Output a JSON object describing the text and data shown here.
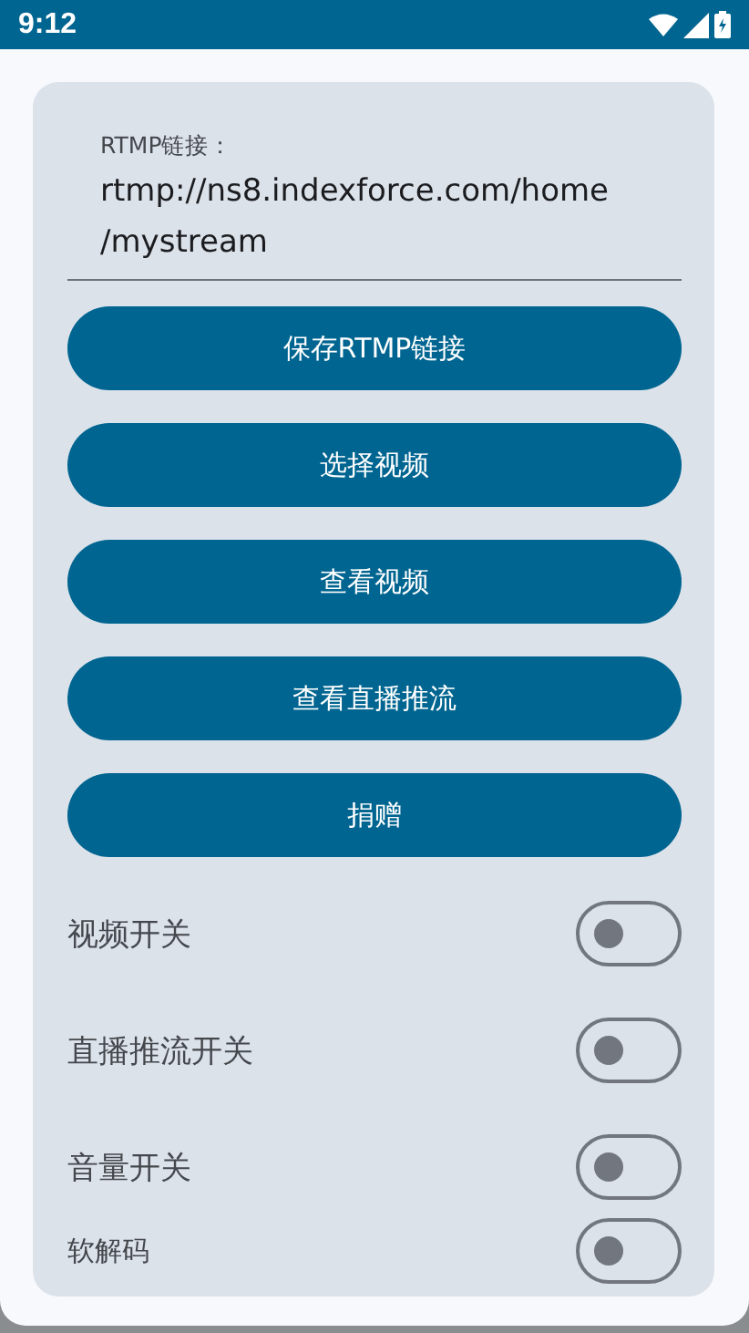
{
  "status_bar": {
    "time": "9:12"
  },
  "url_field": {
    "label": "RTMP链接：",
    "value": "rtmp://ns8.indexforce.com/home\n/mystream"
  },
  "buttons": [
    "保存RTMP链接",
    "选择视频",
    "查看视频",
    "查看直播推流",
    "捐赠"
  ],
  "switches": [
    {
      "label": "视频开关",
      "on": false,
      "kind": "regular"
    },
    {
      "label": "直播推流开关",
      "on": false,
      "kind": "regular"
    },
    {
      "label": "音量开关",
      "on": false,
      "kind": "regular"
    },
    {
      "label": "软解码",
      "on": false,
      "kind": "compact"
    }
  ]
}
